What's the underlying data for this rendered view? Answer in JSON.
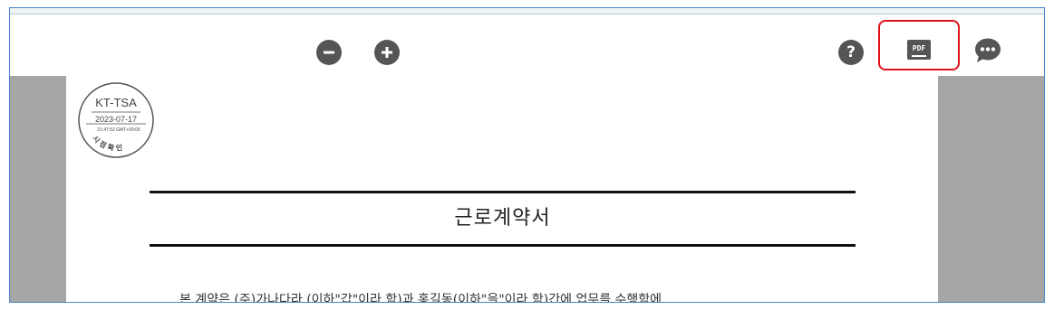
{
  "toolbar": {
    "zoom_out_label": "zoom out",
    "zoom_in_label": "zoom in",
    "help_label": "?",
    "pdf_label": "PDF",
    "chat_label": "..."
  },
  "stamp": {
    "org": "KT-TSA",
    "date": "2023-07-17",
    "time": "21:47:52 GMT+09:00",
    "arc_text": "시 점 확 인"
  },
  "document": {
    "title": "근로계약서",
    "first_line": "본 계약은 (주)가나다라 (이하\"갑\"이라 함)과 홍길동(이하\"을\"이라 함)간에 업무를 수행함에"
  },
  "colors": {
    "accent_red": "#e0121b",
    "icon_gray": "#555555",
    "viewer_bg": "#a6a6a6",
    "frame_border": "#4a86c8"
  },
  "icons": [
    "minus-circle-icon",
    "plus-circle-icon",
    "help-circle-icon",
    "pdf-icon",
    "chat-bubble-icon"
  ]
}
